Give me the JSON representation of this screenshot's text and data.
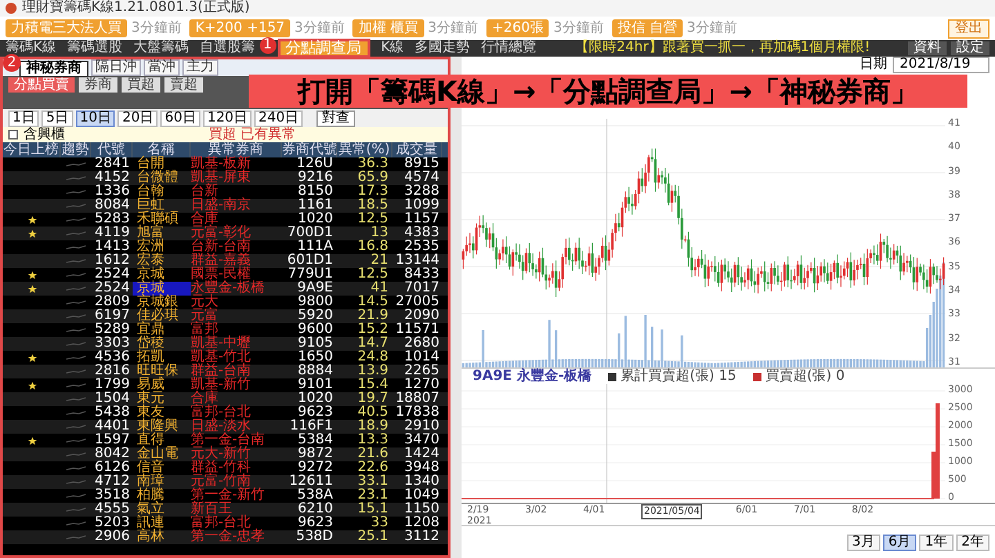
{
  "window": {
    "title": "理財寶籌碼K線1.21.0801.3(正式版)"
  },
  "promo_bar": {
    "items": [
      {
        "text": "力積電三大法人買",
        "time": "3分鐘前"
      },
      {
        "text": "K+200 +157",
        "time": "3分鐘前"
      },
      {
        "text": "加權 櫃買",
        "time": "3分鐘前"
      },
      {
        "text": "+260張",
        "time": "3分鐘前"
      },
      {
        "text": "投信 自營",
        "time": "3分鐘前"
      }
    ],
    "logout": "登出"
  },
  "nav": {
    "items": [
      {
        "label": "籌碼K線",
        "highlighted": false
      },
      {
        "label": "籌碼選股",
        "highlighted": false
      },
      {
        "label": "大盤籌碼",
        "highlighted": false
      },
      {
        "label": "自選股籌",
        "highlighted": false
      },
      {
        "label": "分點調查局",
        "highlighted": true,
        "number": "1"
      },
      {
        "label": "K線",
        "highlighted": false
      },
      {
        "label": "多國走勢",
        "highlighted": false
      },
      {
        "label": "行情總覽",
        "highlighted": false
      }
    ],
    "notice": "【限時24hr】跟著買一抓一，再加碼1個月權限!",
    "buttons": [
      "資料",
      "設定"
    ]
  },
  "banner": "打開「籌碼K線」→「分點調查局」→「神秘券商」",
  "sub_tabs": [
    {
      "label": "神秘券商",
      "highlighted": true,
      "number": "2"
    },
    {
      "label": "隔日沖",
      "highlighted": false
    },
    {
      "label": "當沖",
      "highlighted": false
    },
    {
      "label": "主力",
      "highlighted": false
    }
  ],
  "toolbar_buttons": [
    {
      "label": "分點買賣",
      "selected": true
    },
    {
      "label": "券商",
      "selected": false
    },
    {
      "label": "買超",
      "selected": false
    },
    {
      "label": "賣超",
      "selected": false
    }
  ],
  "period_buttons": [
    {
      "label": "1日",
      "selected": false
    },
    {
      "label": "5日",
      "selected": false
    },
    {
      "label": "10日",
      "selected": true
    },
    {
      "label": "20日",
      "selected": false
    },
    {
      "label": "60日",
      "selected": false
    },
    {
      "label": "120日",
      "selected": false
    },
    {
      "label": "240日",
      "selected": false
    }
  ],
  "query_button": "對查",
  "filter": {
    "label": "含興櫃",
    "checked": false
  },
  "filter_note": "買超 已有異常",
  "table": {
    "columns": [
      "今日上榜",
      "趨勢",
      "代號",
      "名稱",
      "異常券商",
      "券商代號",
      "異常(%)",
      "成交量"
    ],
    "rows": [
      {
        "starred": false,
        "selected": false,
        "code": "2841",
        "name": "台開",
        "broker": "凱基-板新",
        "broker_code": "126U",
        "pct": "36.3",
        "volume": "8915"
      },
      {
        "starred": false,
        "selected": false,
        "code": "4152",
        "name": "台微體",
        "broker": "凱基-屏東",
        "broker_code": "9216",
        "pct": "65.9",
        "volume": "4574"
      },
      {
        "starred": false,
        "selected": false,
        "code": "1336",
        "name": "台翰",
        "broker": "台新",
        "broker_code": "8150",
        "pct": "17.3",
        "volume": "3288"
      },
      {
        "starred": false,
        "selected": false,
        "code": "8084",
        "name": "巨虹",
        "broker": "日盛-南京",
        "broker_code": "1161",
        "pct": "18.5",
        "volume": "1099"
      },
      {
        "starred": true,
        "selected": false,
        "code": "5283",
        "name": "禾聯碩",
        "broker": "合庫",
        "broker_code": "1020",
        "pct": "12.5",
        "volume": "1157"
      },
      {
        "starred": true,
        "selected": false,
        "code": "4119",
        "name": "旭富",
        "broker": "元富-彰化",
        "broker_code": "700D1",
        "pct": "13",
        "volume": "4383"
      },
      {
        "starred": false,
        "selected": false,
        "code": "1413",
        "name": "宏洲",
        "broker": "台新-台南",
        "broker_code": "111A",
        "pct": "16.8",
        "volume": "2535"
      },
      {
        "starred": false,
        "selected": false,
        "code": "1612",
        "name": "宏泰",
        "broker": "群益-嘉義",
        "broker_code": "601D1",
        "pct": "21",
        "volume": "13144"
      },
      {
        "starred": true,
        "selected": false,
        "code": "2524",
        "name": "京城",
        "broker": "國票-民權",
        "broker_code": "779U1",
        "pct": "12.5",
        "volume": "8433"
      },
      {
        "starred": true,
        "selected": true,
        "code": "2524",
        "name": "京城",
        "broker": "永豐金-板橋",
        "broker_code": "9A9E",
        "pct": "41",
        "volume": "7017"
      },
      {
        "starred": false,
        "selected": false,
        "code": "2809",
        "name": "京城銀",
        "broker": "元大",
        "broker_code": "9800",
        "pct": "14.5",
        "volume": "27005"
      },
      {
        "starred": false,
        "selected": false,
        "code": "6197",
        "name": "佳必琪",
        "broker": "元富",
        "broker_code": "5920",
        "pct": "21.9",
        "volume": "2090"
      },
      {
        "starred": false,
        "selected": false,
        "code": "5289",
        "name": "宜鼎",
        "broker": "富邦",
        "broker_code": "9600",
        "pct": "15.2",
        "volume": "11571"
      },
      {
        "starred": false,
        "selected": false,
        "code": "3303",
        "name": "岱稜",
        "broker": "凱基-中壢",
        "broker_code": "9105",
        "pct": "14.7",
        "volume": "2680"
      },
      {
        "starred": true,
        "selected": false,
        "code": "4536",
        "name": "拓凱",
        "broker": "凱基-竹北",
        "broker_code": "1650",
        "pct": "24.8",
        "volume": "1014"
      },
      {
        "starred": false,
        "selected": false,
        "code": "2816",
        "name": "旺旺保",
        "broker": "群益-台南",
        "broker_code": "8884",
        "pct": "13.9",
        "volume": "2265"
      },
      {
        "starred": true,
        "selected": false,
        "code": "1799",
        "name": "易威",
        "broker": "凱基-新竹",
        "broker_code": "9101",
        "pct": "15.4",
        "volume": "1270"
      },
      {
        "starred": false,
        "selected": false,
        "code": "1504",
        "name": "東元",
        "broker": "合庫",
        "broker_code": "1020",
        "pct": "19.7",
        "volume": "18807"
      },
      {
        "starred": false,
        "selected": false,
        "code": "5438",
        "name": "東友",
        "broker": "富邦-台北",
        "broker_code": "9623",
        "pct": "40.5",
        "volume": "17838"
      },
      {
        "starred": false,
        "selected": false,
        "code": "4401",
        "name": "東隆興",
        "broker": "日盛-淡水",
        "broker_code": "116F1",
        "pct": "18.9",
        "volume": "2910"
      },
      {
        "starred": true,
        "selected": false,
        "code": "1597",
        "name": "直得",
        "broker": "第一金-台南",
        "broker_code": "5384",
        "pct": "13.3",
        "volume": "3470"
      },
      {
        "starred": false,
        "selected": false,
        "code": "8042",
        "name": "金山電",
        "broker": "元大-新竹",
        "broker_code": "9872",
        "pct": "21.6",
        "volume": "1424"
      },
      {
        "starred": false,
        "selected": false,
        "code": "6126",
        "name": "信音",
        "broker": "群益-竹科",
        "broker_code": "9272",
        "pct": "22.6",
        "volume": "3948"
      },
      {
        "starred": false,
        "selected": false,
        "code": "4712",
        "name": "南璋",
        "broker": "元富-竹南",
        "broker_code": "12611",
        "pct": "33.1",
        "volume": "1340"
      },
      {
        "starred": false,
        "selected": false,
        "code": "3518",
        "name": "柏騰",
        "broker": "第一金-新竹",
        "broker_code": "538A",
        "pct": "23.1",
        "volume": "1049"
      },
      {
        "starred": false,
        "selected": false,
        "code": "4555",
        "name": "氣立",
        "broker": "新百王",
        "broker_code": "6210",
        "pct": "15.1",
        "volume": "1150"
      },
      {
        "starred": false,
        "selected": false,
        "code": "5203",
        "name": "訊連",
        "broker": "富邦-台北",
        "broker_code": "9623",
        "pct": "33",
        "volume": "1208"
      },
      {
        "starred": false,
        "selected": false,
        "code": "2906",
        "name": "高林",
        "broker": "第一金-忠孝",
        "broker_code": "538D",
        "pct": "25.1",
        "volume": "3112"
      }
    ]
  },
  "chart_panel": {
    "date_label": "日期",
    "date_value": "2021/8/19",
    "price_ticks": [
      "41",
      "40",
      "39",
      "38",
      "37",
      "36",
      "35",
      "34",
      "33",
      "32",
      "31"
    ],
    "legend_title": "9A9E 永豐金-板橋",
    "legends": [
      {
        "label": "累計買賣超(張) 15",
        "color": "#333333"
      },
      {
        "label": "買賣超(張) 0",
        "color": "#c83030"
      }
    ],
    "volume_ticks": [
      "3000",
      "2500",
      "2000",
      "1500",
      "1000",
      "500",
      "0"
    ],
    "x_labels": [
      "2/19 2021",
      "3/02",
      "4/01",
      "2021/05/04",
      "6/01",
      "7/01",
      "8/02"
    ],
    "range_buttons": [
      {
        "label": "3月",
        "selected": false
      },
      {
        "label": "6月",
        "selected": true
      },
      {
        "label": "1年",
        "selected": false
      },
      {
        "label": "2年",
        "selected": false
      }
    ]
  }
}
